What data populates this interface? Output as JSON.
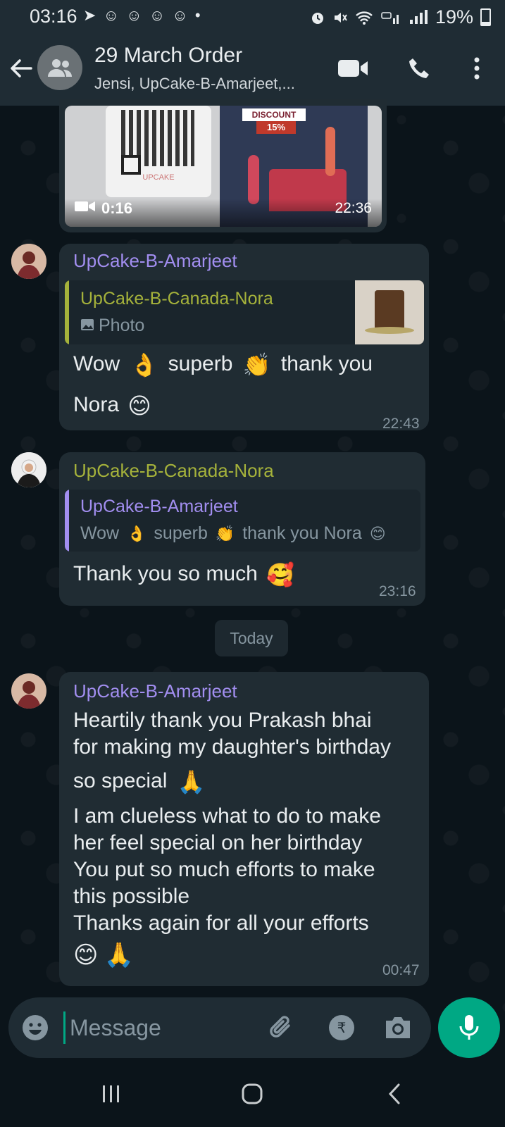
{
  "status_bar": {
    "time": "03:16",
    "left_icons": "➤ ☺ ☺ ☺ ☺ •",
    "battery": "19%"
  },
  "header": {
    "title": "29 March Order",
    "subtitle": "Jensi, UpCake-B-Amarjeet,...",
    "icons": [
      "back-arrow-icon",
      "group-avatar-icon",
      "video-call-icon",
      "voice-call-icon",
      "more-options-icon"
    ]
  },
  "video_message": {
    "discount_label": "DISCOUNT",
    "discount_value": "15%",
    "brand": "UPCAKE",
    "duration": "0:16",
    "time": "22:36"
  },
  "messages": [
    {
      "sender": "UpCake-B-Amarjeet",
      "quote_sender": "UpCake-B-Canada-Nora",
      "quote_text": "Photo",
      "line1_a": "Wow",
      "line1_b": "superb",
      "line1_c": "thank you",
      "line2": "Nora",
      "time": "22:43"
    },
    {
      "sender": "UpCake-B-Canada-Nora",
      "quote_sender": "UpCake-B-Amarjeet",
      "quote_a": "Wow",
      "quote_b": "superb",
      "quote_c": "thank you Nora",
      "text": "Thank you so much",
      "time": "23:16"
    },
    {
      "sender": "UpCake-B-Amarjeet",
      "lines": [
        "Heartily thank you Prakash bhai",
        "for making my daughter's birthday",
        "so special",
        "I am clueless what to do to make",
        "her feel special on her birthday",
        "You put so much efforts to make",
        "this possible",
        "Thanks again for all your efforts"
      ],
      "time": "00:47"
    }
  ],
  "date_chip": "Today",
  "composer": {
    "placeholder": "Message",
    "icons": [
      "emoji-icon",
      "attach-icon",
      "rupee-payment-icon",
      "camera-icon",
      "mic-icon"
    ]
  },
  "colors": {
    "background": "#0b141a",
    "bubble": "#202c33",
    "header": "#1f2c34",
    "accent": "#00a884",
    "amarjeet_name": "#a28ef0",
    "nora_name": "#a5b23b",
    "meta_text": "#8696a0"
  }
}
